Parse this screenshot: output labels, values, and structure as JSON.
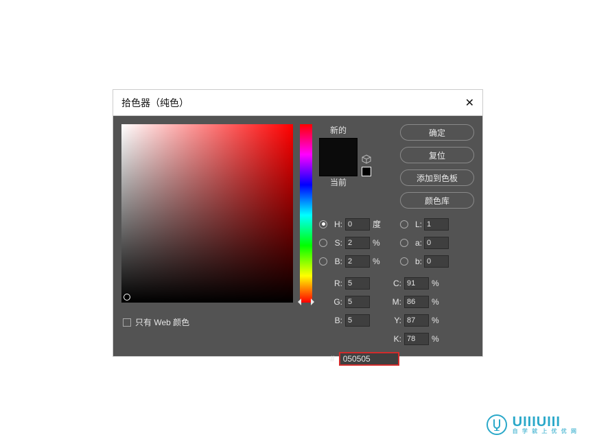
{
  "dialog": {
    "title": "拾色器（纯色）"
  },
  "preview": {
    "new_label": "新的",
    "current_label": "当前"
  },
  "buttons": {
    "ok": "确定",
    "reset": "复位",
    "add_swatch": "添加到色板",
    "color_lib": "颜色库"
  },
  "fields": {
    "H": {
      "label": "H:",
      "value": "0",
      "unit": "度"
    },
    "S": {
      "label": "S:",
      "value": "2",
      "unit": "%"
    },
    "Bv": {
      "label": "B:",
      "value": "2",
      "unit": "%"
    },
    "L": {
      "label": "L:",
      "value": "1"
    },
    "a": {
      "label": "a:",
      "value": "0"
    },
    "b": {
      "label": "b:",
      "value": "0"
    },
    "R": {
      "label": "R:",
      "value": "5"
    },
    "G": {
      "label": "G:",
      "value": "5"
    },
    "Bc": {
      "label": "B:",
      "value": "5"
    },
    "C": {
      "label": "C:",
      "value": "91",
      "unit": "%"
    },
    "M": {
      "label": "M:",
      "value": "86",
      "unit": "%"
    },
    "Y": {
      "label": "Y:",
      "value": "87",
      "unit": "%"
    },
    "K": {
      "label": "K:",
      "value": "78",
      "unit": "%"
    },
    "hex": {
      "label": "#",
      "value": "050505"
    }
  },
  "webonly": {
    "label": "只有 Web 颜色"
  },
  "brand": {
    "name": "UIIIUIII",
    "sub": "自 学 就 上 优 优 网"
  }
}
